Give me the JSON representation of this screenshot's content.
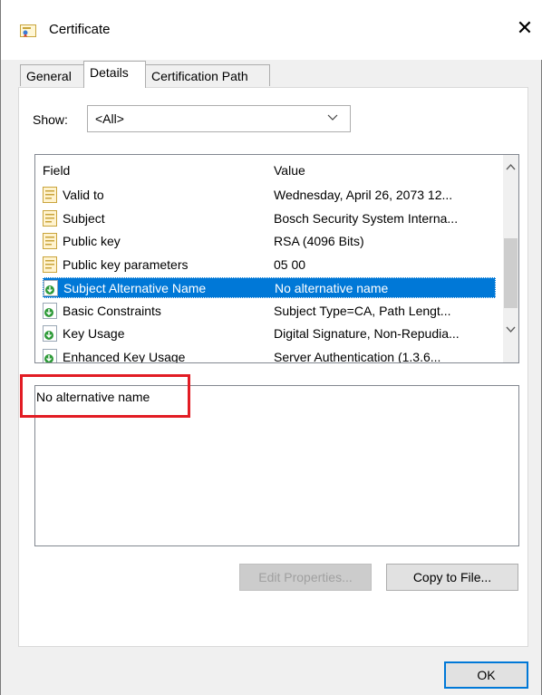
{
  "window": {
    "title": "Certificate",
    "close_glyph": "✕"
  },
  "tabs": [
    {
      "label": "General"
    },
    {
      "label": "Details",
      "active": true
    },
    {
      "label": "Certification Path"
    }
  ],
  "show": {
    "label": "Show:",
    "selected": "<All>"
  },
  "list": {
    "columns": {
      "field": "Field",
      "value": "Value"
    },
    "rows": [
      {
        "field": "Valid to",
        "value": "Wednesday, April 26, 2073 12...",
        "icon": "document-icon"
      },
      {
        "field": "Subject",
        "value": "Bosch Security System Interna...",
        "icon": "document-icon"
      },
      {
        "field": "Public key",
        "value": "RSA (4096 Bits)",
        "icon": "document-icon"
      },
      {
        "field": "Public key parameters",
        "value": "05 00",
        "icon": "document-icon"
      },
      {
        "field": "Subject Alternative Name",
        "value": "No alternative name",
        "icon": "extension-download-icon",
        "selected": true
      },
      {
        "field": "Basic Constraints",
        "value": "Subject Type=CA, Path Lengt...",
        "icon": "extension-download-icon"
      },
      {
        "field": "Key Usage",
        "value": "Digital Signature, Non-Repudia...",
        "icon": "extension-download-icon"
      },
      {
        "field": "Enhanced Key Usage",
        "value": "Server Authentication (1.3.6...",
        "icon": "extension-download-icon"
      }
    ]
  },
  "detail": {
    "text": "No alternative name"
  },
  "buttons": {
    "edit_properties": "Edit Properties...",
    "copy_to_file": "Copy to File...",
    "ok": "OK"
  },
  "colors": {
    "selection": "#0078d7",
    "highlight": "#e21c24"
  }
}
